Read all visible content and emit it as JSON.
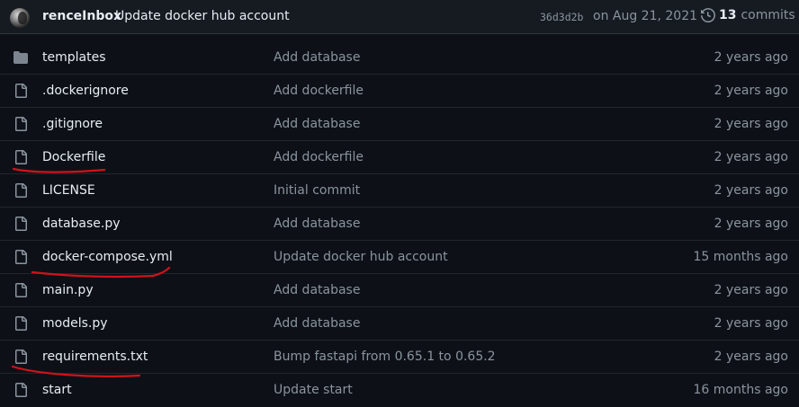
{
  "latest_commit": {
    "author": "renceInbox",
    "message": "Update docker hub account",
    "sha": "36d3d2b",
    "date": "on Aug 21, 2021",
    "commit_count": "13",
    "commits_label": "commits"
  },
  "files": [
    {
      "type": "folder",
      "name": "templates",
      "message": "Add database",
      "age": "2 years ago"
    },
    {
      "type": "file",
      "name": ".dockerignore",
      "message": "Add dockerfile",
      "age": "2 years ago"
    },
    {
      "type": "file",
      "name": ".gitignore",
      "message": "Add database",
      "age": "2 years ago"
    },
    {
      "type": "file",
      "name": "Dockerfile",
      "message": "Add dockerfile",
      "age": "2 years ago",
      "highlighted": true
    },
    {
      "type": "file",
      "name": "LICENSE",
      "message": "Initial commit",
      "age": "2 years ago"
    },
    {
      "type": "file",
      "name": "database.py",
      "message": "Add database",
      "age": "2 years ago"
    },
    {
      "type": "file",
      "name": "docker-compose.yml",
      "message": "Update docker hub account",
      "age": "15 months ago",
      "highlighted": true
    },
    {
      "type": "file",
      "name": "main.py",
      "message": "Add database",
      "age": "2 years ago"
    },
    {
      "type": "file",
      "name": "models.py",
      "message": "Add database",
      "age": "2 years ago"
    },
    {
      "type": "file",
      "name": "requirements.txt",
      "message": "Bump fastapi from 0.65.1 to 0.65.2",
      "age": "2 years ago",
      "highlighted": true
    },
    {
      "type": "file",
      "name": "start",
      "message": "Update start",
      "age": "16 months ago"
    }
  ],
  "colors": {
    "background": "#0d1117",
    "header_background": "#161b22",
    "annotation": "#d1121b",
    "icon": "#8b949e",
    "folder_icon": "#7d8590"
  }
}
